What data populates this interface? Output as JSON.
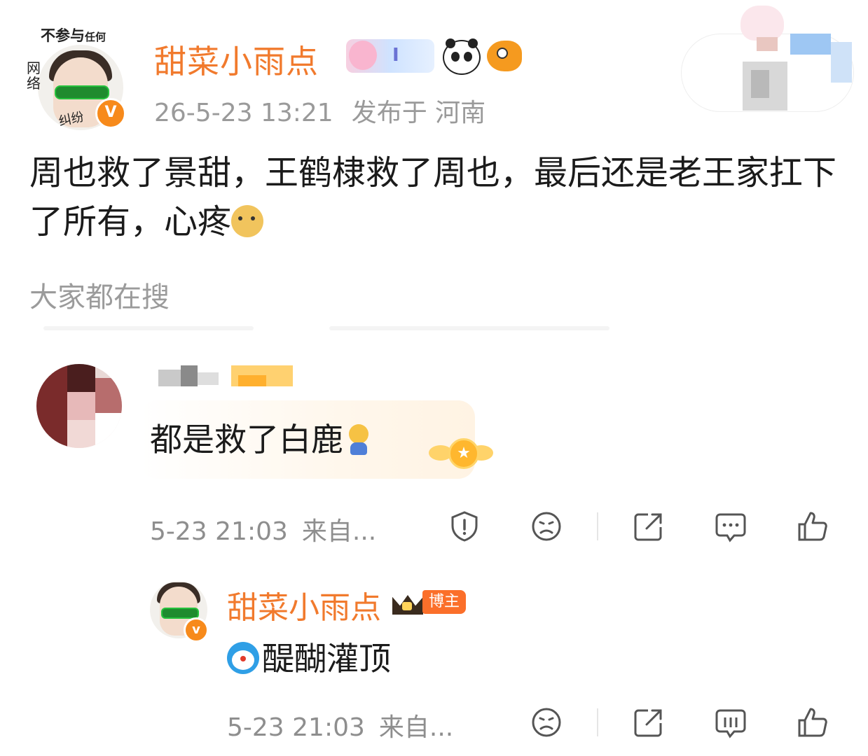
{
  "post": {
    "author": "甜菜小雨点",
    "avatar_top_text": "不参与",
    "avatar_top_text_small": "任何",
    "avatar_side_text": "网络",
    "avatar_bottom_text": "纠纷",
    "verified_mark": "V",
    "badge_level": "I",
    "timestamp": "26-5-23 13:21",
    "location": "发布于 河南",
    "text": "周也救了景甜，王鹤棣救了周也，最后还是老王家扛下了所有，心疼",
    "emoji": "doge-emoji",
    "trending_label": "大家都在搜"
  },
  "comment": {
    "author_blurred": true,
    "text": "都是救了白鹿",
    "emoji": "smile-emoji",
    "timestamp": "5-23 21:03",
    "source": "来自...",
    "badge_icon": "star-wing-badge",
    "actions": [
      "report-icon",
      "dislike-icon",
      "share-icon",
      "comment-icon",
      "like-icon"
    ]
  },
  "reply": {
    "author": "甜菜小雨点",
    "verified_mark": "v",
    "host_label": "博主",
    "emoji": "doraemon-emoji",
    "text": "醍醐灌顶",
    "timestamp": "5-23 21:03",
    "source": "来自...",
    "actions": [
      "dislike-icon",
      "share-icon",
      "comment-icon",
      "like-icon"
    ]
  },
  "colors": {
    "username": "#f17a2d",
    "meta_gray": "#9a9a9a",
    "verified_orange": "#f78a1b",
    "host_badge": "#fb6f2a"
  }
}
